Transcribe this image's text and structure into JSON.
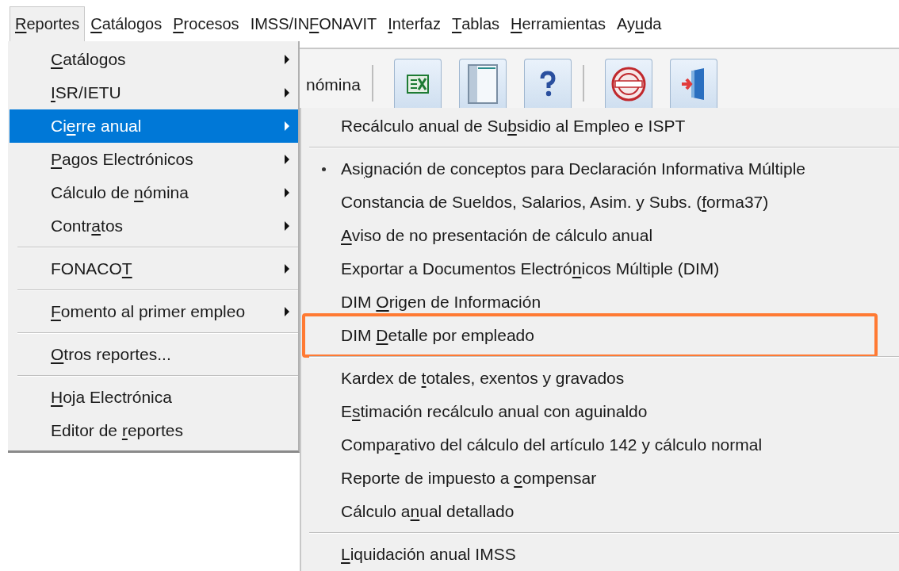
{
  "menu_bar": [
    {
      "label": {
        "key": "R",
        "post": "eportes"
      },
      "selected": true
    },
    {
      "label": {
        "key": "C",
        "post": "atálogos"
      },
      "selected": false
    },
    {
      "label": {
        "key": "P",
        "post": "rocesos"
      },
      "selected": false
    },
    {
      "label": {
        "pre": "IMSS/IN",
        "key": "F",
        "post": "ONAVIT"
      },
      "selected": false
    },
    {
      "label": {
        "key": "I",
        "post": "nterfaz"
      },
      "selected": false
    },
    {
      "label": {
        "key": "T",
        "post": "ablas"
      },
      "selected": false
    },
    {
      "label": {
        "key": "H",
        "post": "erramientas"
      },
      "selected": false
    },
    {
      "label": {
        "pre": "Ay",
        "key": "u",
        "post": "da"
      },
      "selected": false
    }
  ],
  "toolbar": {
    "partial_label": "nómina",
    "buttons": [
      {
        "kind": "excel"
      },
      {
        "kind": "panel"
      },
      {
        "kind": "help"
      },
      {
        "kind": "separator"
      },
      {
        "kind": "stamp"
      },
      {
        "kind": "exit"
      }
    ]
  },
  "reports_menu": [
    {
      "kind": "item",
      "label": {
        "key": "C",
        "post": "atálogos"
      },
      "submenu": true,
      "selected": false
    },
    {
      "kind": "item",
      "label": {
        "key": "I",
        "post": "SR/IETU"
      },
      "submenu": true,
      "selected": false
    },
    {
      "kind": "item",
      "label": {
        "pre": "Ci",
        "key": "e",
        "post": "rre anual"
      },
      "submenu": true,
      "selected": true
    },
    {
      "kind": "item",
      "label": {
        "key": "P",
        "post": "agos Electrónicos"
      },
      "submenu": true,
      "selected": false
    },
    {
      "kind": "item",
      "label": {
        "pre": "Cálculo de ",
        "key": "n",
        "post": "ómina"
      },
      "submenu": true,
      "selected": false
    },
    {
      "kind": "item",
      "label": {
        "pre": "Contr",
        "key": "a",
        "post": "tos"
      },
      "submenu": true,
      "selected": false
    },
    {
      "kind": "separator"
    },
    {
      "kind": "item",
      "label": {
        "pre": "FONACO",
        "key": "T"
      },
      "submenu": true,
      "selected": false
    },
    {
      "kind": "separator"
    },
    {
      "kind": "item",
      "label": {
        "key": "F",
        "post": "omento al primer empleo"
      },
      "submenu": true,
      "selected": false
    },
    {
      "kind": "separator"
    },
    {
      "kind": "item",
      "label": {
        "key": "O",
        "post": "tros reportes..."
      },
      "submenu": false,
      "selected": false
    },
    {
      "kind": "separator"
    },
    {
      "kind": "item",
      "label": {
        "key": "H",
        "post": "oja Electrónica"
      },
      "submenu": false,
      "selected": false
    },
    {
      "kind": "item",
      "label": {
        "pre": "Editor de ",
        "key": "r",
        "post": "eportes"
      },
      "submenu": false,
      "selected": false
    }
  ],
  "annual_close_menu": [
    {
      "kind": "item",
      "label": {
        "pre": "Recálculo anual de Su",
        "key": "b",
        "post": "sidio al Empleo e ISPT"
      },
      "checked": false,
      "highlighted": false
    },
    {
      "kind": "separator"
    },
    {
      "kind": "item",
      "label": {
        "pre": "Asi",
        "key": "g",
        "post": "nación de conceptos para Declaración Informativa Múltiple"
      },
      "checked": true,
      "highlighted": false
    },
    {
      "kind": "item",
      "label": {
        "pre": "Constancia de Sueldos, Salarios, Asim. y Subs. (",
        "key": "f",
        "post": "orma37)"
      },
      "checked": false,
      "highlighted": false
    },
    {
      "kind": "item",
      "label": {
        "key": "A",
        "post": "viso de no presentación de cálculo anual"
      },
      "checked": false,
      "highlighted": false
    },
    {
      "kind": "item",
      "label": {
        "pre": "Exportar a Documentos Electró",
        "key": "n",
        "post": "icos Múltiple (DIM)"
      },
      "checked": false,
      "highlighted": false
    },
    {
      "kind": "item",
      "label": {
        "pre": "DIM ",
        "key": "O",
        "post": "rigen de Información"
      },
      "checked": false,
      "highlighted": false
    },
    {
      "kind": "item",
      "label": {
        "pre": "DIM ",
        "key": "D",
        "post": "etalle por empleado"
      },
      "checked": false,
      "highlighted": true
    },
    {
      "kind": "separator"
    },
    {
      "kind": "item",
      "label": {
        "pre": "Kardex de ",
        "key": "t",
        "post": "otales, exentos y gravados"
      },
      "checked": false,
      "highlighted": false
    },
    {
      "kind": "item",
      "label": {
        "pre": "E",
        "key": "s",
        "post": "timación recálculo anual con aguinaldo"
      },
      "checked": false,
      "highlighted": false
    },
    {
      "kind": "item",
      "label": {
        "pre": "Compa",
        "key": "r",
        "post": "ativo del cálculo del artículo 142 y cálculo normal"
      },
      "checked": false,
      "highlighted": false
    },
    {
      "kind": "item",
      "label": {
        "pre": "Reporte de impuesto a ",
        "key": "c",
        "post": "ompensar"
      },
      "checked": false,
      "highlighted": false
    },
    {
      "kind": "item",
      "label": {
        "pre": "Cálculo a",
        "key": "n",
        "post": "ual detallado"
      },
      "checked": false,
      "highlighted": false
    },
    {
      "kind": "separator"
    },
    {
      "kind": "item",
      "label": {
        "key": "L",
        "post": "iquidación anual IMSS"
      },
      "checked": false,
      "highlighted": false
    }
  ]
}
